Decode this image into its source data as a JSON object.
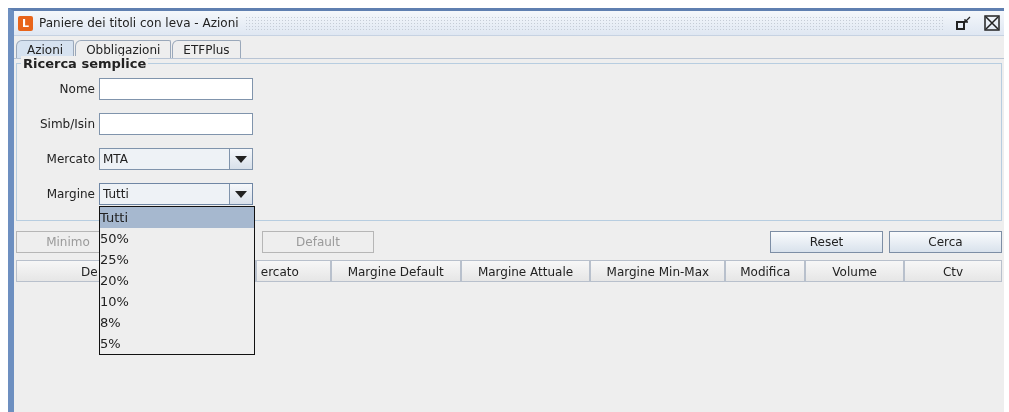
{
  "window": {
    "title": "Paniere dei titoli con leva - Azioni",
    "logo": "L"
  },
  "tabs": [
    {
      "label": "Azioni",
      "selected": true
    },
    {
      "label": "Obbligazioni",
      "selected": false
    },
    {
      "label": "ETFPlus",
      "selected": false
    }
  ],
  "search": {
    "title": "Ricerca semplice",
    "fields": [
      {
        "label": "Nome",
        "kind": "text"
      },
      {
        "label": "Simb/Isin",
        "kind": "text"
      },
      {
        "label": "Mercato",
        "kind": "combo",
        "value": "MTA",
        "open": false
      },
      {
        "label": "Margine",
        "kind": "combo",
        "value": "Tutti",
        "open": true
      }
    ]
  },
  "dropdown": {
    "options": [
      {
        "label": "Tutti",
        "selected": true
      },
      {
        "label": "50%",
        "selected": false
      },
      {
        "label": "25%",
        "selected": false
      },
      {
        "label": "20%",
        "selected": false
      },
      {
        "label": "10%",
        "selected": false
      },
      {
        "label": "8%",
        "selected": false
      },
      {
        "label": "5%",
        "selected": false
      }
    ]
  },
  "buttons_left": [
    {
      "label": "Minimo",
      "disabled": true
    },
    {
      "label": "Default",
      "disabled": true
    }
  ],
  "buttons_right": [
    {
      "label": "Reset",
      "disabled": false
    },
    {
      "label": "Cerca",
      "disabled": false
    }
  ],
  "table": {
    "columns": [
      "De",
      "ercato",
      "Margine Default",
      "Margine Attuale",
      "Margine Min-Max",
      "Modifica",
      "Volume",
      "Ctv"
    ]
  }
}
